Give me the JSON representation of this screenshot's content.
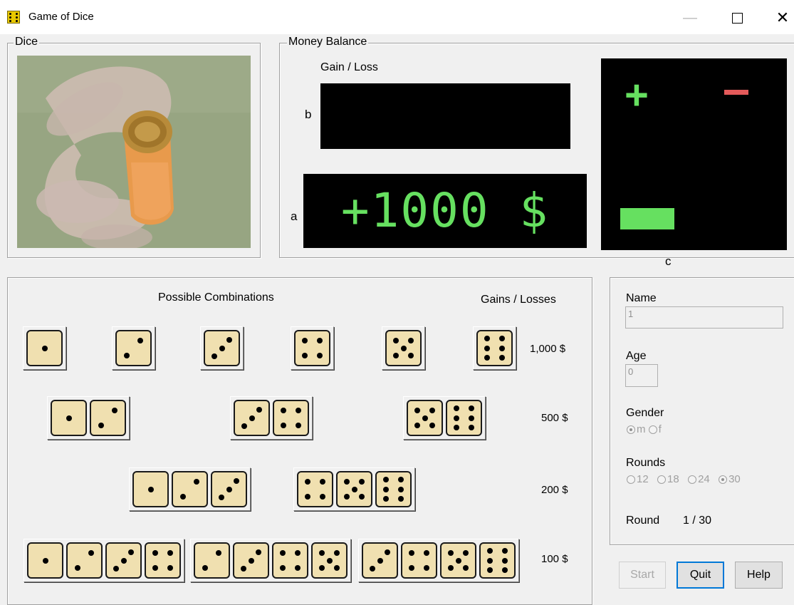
{
  "window": {
    "title": "Game of Dice",
    "controls": [
      "minimize",
      "maximize",
      "close"
    ]
  },
  "dice_panel": {
    "label": "Dice",
    "image": "hand shaking orange dice cup"
  },
  "money_panel": {
    "label": "Money Balance",
    "gain_loss_label": "Gain / Loss",
    "marker_b": "b",
    "marker_a": "a",
    "marker_c": "c",
    "balance": "+1000 $",
    "plus_symbol": "+",
    "colors": {
      "display_green": "#66e060",
      "minus_red": "#e45a5a",
      "display_bg": "#000000"
    }
  },
  "combinations": {
    "title": "Possible Combinations",
    "gains_header": "Gains / Losses",
    "rows": [
      {
        "gain": "1,000 $",
        "groups": [
          [
            1
          ],
          [
            2
          ],
          [
            3
          ],
          [
            4
          ],
          [
            5
          ],
          [
            6
          ]
        ]
      },
      {
        "gain": "500 $",
        "groups": [
          [
            1,
            2
          ],
          [
            3,
            4
          ],
          [
            5,
            6
          ]
        ]
      },
      {
        "gain": "200 $",
        "groups": [
          [
            1,
            2,
            3
          ],
          [
            4,
            5,
            6
          ]
        ]
      },
      {
        "gain": "100 $",
        "groups": [
          [
            1,
            2,
            3,
            4
          ],
          [
            2,
            3,
            4,
            5
          ],
          [
            3,
            4,
            5,
            6
          ]
        ]
      }
    ]
  },
  "player": {
    "name_label": "Name",
    "name_value": "1",
    "age_label": "Age",
    "age_value": "0",
    "gender_label": "Gender",
    "gender_options": [
      "m",
      "f"
    ],
    "gender_selected": "m",
    "rounds_label": "Rounds",
    "rounds_options": [
      "12",
      "18",
      "24",
      "30"
    ],
    "rounds_selected": "30",
    "round_label": "Round",
    "round_value": "1 / 30"
  },
  "buttons": {
    "start": "Start",
    "quit": "Quit",
    "help": "Help"
  }
}
